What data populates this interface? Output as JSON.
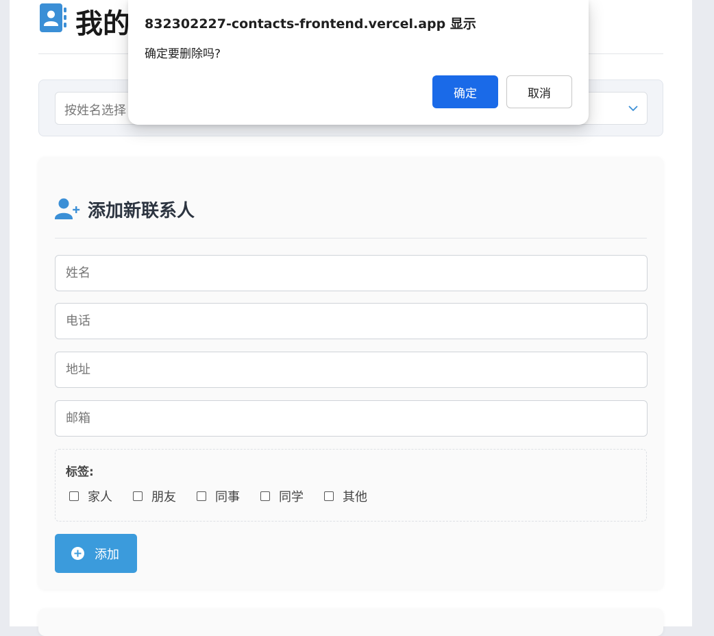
{
  "header": {
    "title": "我的"
  },
  "filter": {
    "placeholder": "按姓名选择"
  },
  "form": {
    "title": "添加新联系人",
    "fields": {
      "name_placeholder": "姓名",
      "phone_placeholder": "电话",
      "address_placeholder": "地址",
      "email_placeholder": "邮箱"
    },
    "tags_label": "标签:",
    "tags": [
      "家人",
      "朋友",
      "同事",
      "同学",
      "其他"
    ],
    "add_label": "添加"
  },
  "dialog": {
    "origin": "832302227-contacts-frontend.vercel.app 显示",
    "message": "确定要删除吗?",
    "ok_label": "确定",
    "cancel_label": "取消"
  },
  "colors": {
    "accent": "#3b9bdc",
    "dialog_primary": "#1a6ae8"
  },
  "icons": {
    "header": "contact-book-icon",
    "form": "user-plus-icon",
    "add": "plus-circle-icon",
    "select": "chevron-down-icon"
  }
}
